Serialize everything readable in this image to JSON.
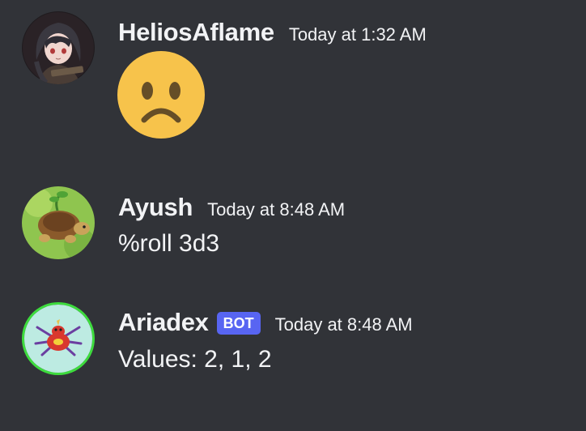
{
  "messages": [
    {
      "username": "HeliosAflame",
      "timestamp": "Today at 1:32 AM",
      "emoji": "frowning-face"
    },
    {
      "username": "Ayush",
      "timestamp": "Today at 8:48 AM",
      "content": "%roll 3d3"
    },
    {
      "username": "Ariadex",
      "bot_tag": "BOT",
      "timestamp": "Today at 8:48 AM",
      "content": "Values: 2, 1, 2"
    }
  ],
  "colors": {
    "background": "#313338",
    "text": "#f2f3f5",
    "bot_tag": "#5865f2",
    "emoji_face": "#f7c34b",
    "emoji_features": "#664e27",
    "ariadex_ring": "#3ddc3d"
  }
}
